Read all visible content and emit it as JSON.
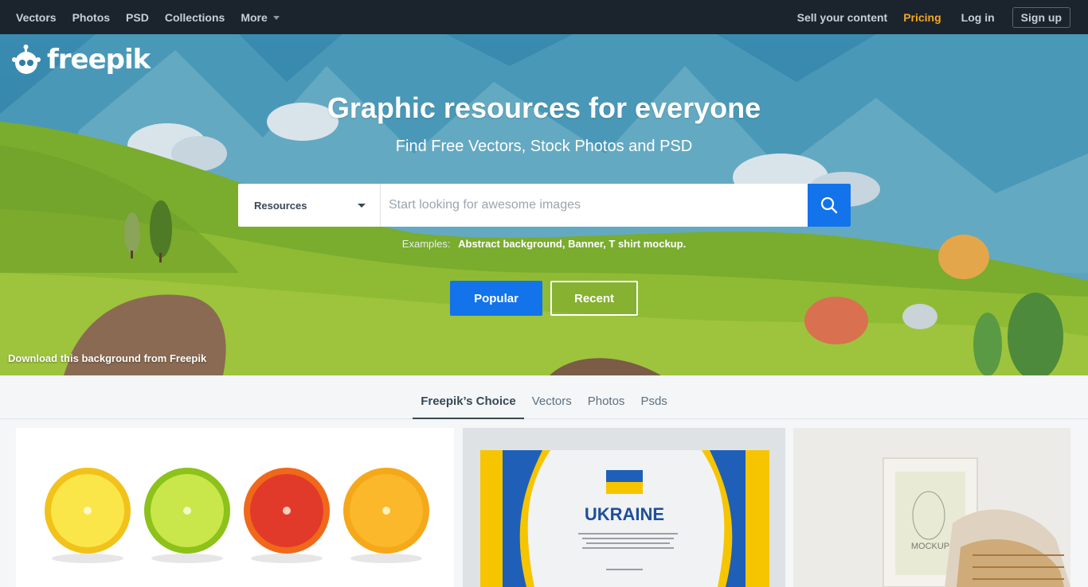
{
  "nav": {
    "left": [
      {
        "label": "Vectors"
      },
      {
        "label": "Photos"
      },
      {
        "label": "PSD"
      },
      {
        "label": "Collections"
      },
      {
        "label": "More"
      }
    ],
    "sell": "Sell your content",
    "pricing": "Pricing",
    "login": "Log in",
    "signup": "Sign up"
  },
  "brand": {
    "name": "freepik"
  },
  "hero": {
    "title": "Graphic resources for everyone",
    "subtitle": "Find Free Vectors, Stock Photos and PSD",
    "search": {
      "category": "Resources",
      "placeholder": "Start looking for awesome images"
    },
    "examples_label": "Examples:",
    "examples": "Abstract background, Banner, T shirt mockup.",
    "popular": "Popular",
    "recent": "Recent",
    "credit": "Download this background from Freepik"
  },
  "tabs": [
    {
      "label": "Freepik’s Choice",
      "active": true
    },
    {
      "label": "Vectors"
    },
    {
      "label": "Photos"
    },
    {
      "label": "Psds"
    }
  ],
  "cards": {
    "ukraine_title": "UKRAINE",
    "mockup_label": "MOCKUP"
  },
  "colors": {
    "accent": "#1273eb",
    "pricing": "#f5a623",
    "nav_bg": "#1b242c"
  }
}
